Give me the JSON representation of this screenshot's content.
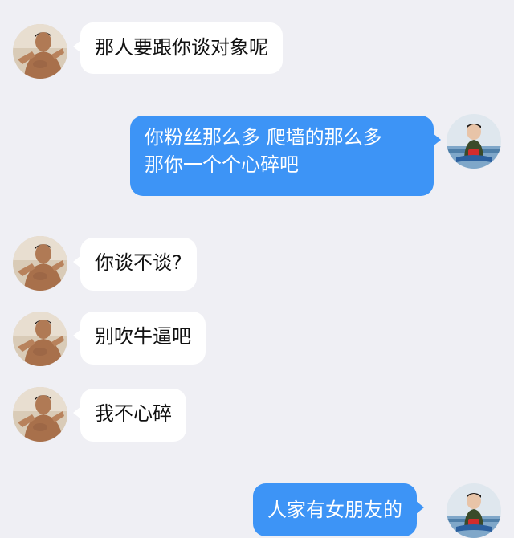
{
  "messages": [
    {
      "side": "in",
      "lines": [
        "那人要跟你谈对象呢"
      ],
      "avatar": "bruce-lee-avatar"
    },
    {
      "side": "out",
      "lines": [
        "你粉丝那么多 爬墙的那么多",
        "那你一个个心碎吧"
      ],
      "avatar": "kid-avatar"
    },
    {
      "side": "in",
      "lines": [
        "你谈不谈?"
      ],
      "avatar": "bruce-lee-avatar"
    },
    {
      "side": "in",
      "lines": [
        "别吹牛逼吧"
      ],
      "avatar": "bruce-lee-avatar"
    },
    {
      "side": "in",
      "lines": [
        "我不心碎"
      ],
      "avatar": "bruce-lee-avatar"
    },
    {
      "side": "out",
      "lines": [
        "人家有女朋友的"
      ],
      "avatar": "kid-avatar"
    }
  ],
  "colors": {
    "background": "#efeff4",
    "incoming_bubble": "#ffffff",
    "outgoing_bubble": "#3d94f6",
    "outgoing_text": "#ffffff",
    "incoming_text": "#111111"
  }
}
